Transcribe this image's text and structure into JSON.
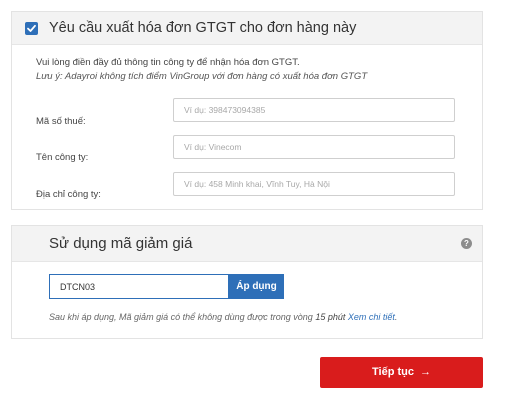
{
  "invoice": {
    "checkbox_checked": true,
    "title": "Yêu cầu xuất hóa đơn GTGT cho đơn hàng này",
    "intro": "Vui lòng điền đầy đủ thông tin công ty để nhận hóa đơn GTGT.",
    "note": "Lưu ý: Adayroi không tích điểm VinGroup với đơn hàng có xuất hóa đơn GTGT",
    "fields": [
      {
        "label": "Mã số thuế:",
        "placeholder": "Ví dụ: 398473094385",
        "value": ""
      },
      {
        "label": "Tên công ty:",
        "placeholder": "Ví dụ: Vinecom",
        "value": ""
      },
      {
        "label": "Địa chỉ công ty:",
        "placeholder": "Ví dụ: 458 Minh khai, Vĩnh Tuy, Hà Nội",
        "value": ""
      }
    ]
  },
  "discount": {
    "title": "Sử dụng mã giảm giá",
    "help_icon": "question-icon",
    "help_glyph": "?",
    "code_value": "DTCN03",
    "apply_label": "Áp dụng",
    "note_before": "Sau khi áp dụng, Mã giảm giá có thể không dùng được trong vòng ",
    "note_minutes": "15 phút",
    "note_link": "Xem chi tiết",
    "note_end": "."
  },
  "continue_button": {
    "label": "Tiếp tục",
    "arrow": "→"
  },
  "colors": {
    "accent_blue": "#2e6fb8",
    "continue_red": "#d91c1c",
    "panel_header_bg": "#f3f3f3"
  }
}
